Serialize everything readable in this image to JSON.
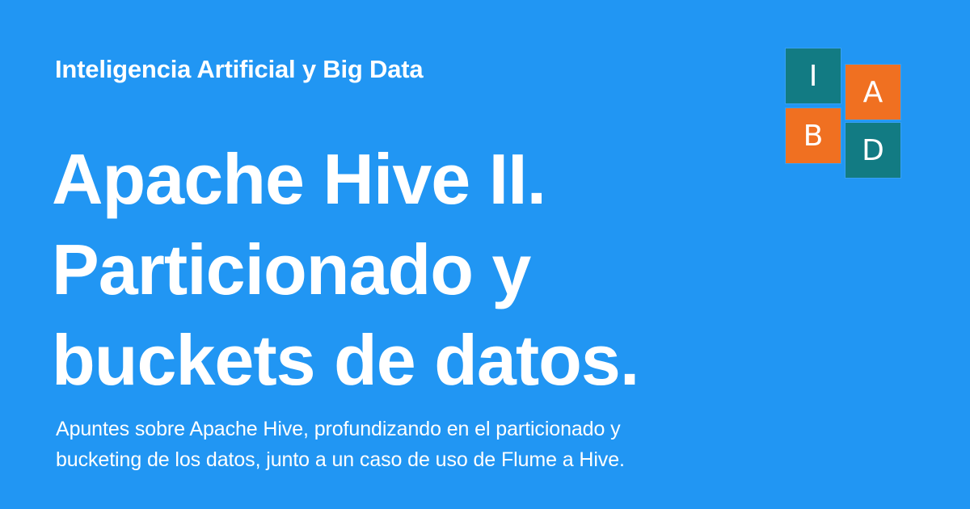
{
  "header": {
    "site_name": "Inteligencia Artificial y Big Data"
  },
  "title": {
    "lines": [
      "Apache Hive II.",
      "Particionado y",
      "buckets de datos."
    ]
  },
  "description": {
    "lines": [
      "Apuntes sobre Apache Hive, profundizando en el particionado y",
      "bucketing de los datos, junto a un caso de uso de Flume a Hive."
    ]
  },
  "logo": {
    "tiles": [
      {
        "letter": "I",
        "color": "#127b83"
      },
      {
        "letter": "A",
        "color": "#f07021"
      },
      {
        "letter": "B",
        "color": "#f07021"
      },
      {
        "letter": "D",
        "color": "#127b83"
      }
    ]
  },
  "colors": {
    "background": "#2196f3",
    "text": "#ffffff"
  }
}
